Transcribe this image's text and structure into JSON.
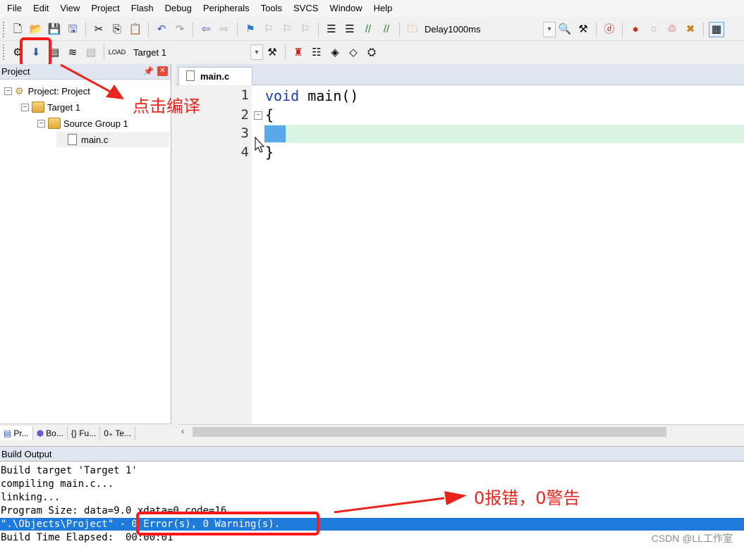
{
  "menu": [
    "File",
    "Edit",
    "View",
    "Project",
    "Flash",
    "Debug",
    "Peripherals",
    "Tools",
    "SVCS",
    "Window",
    "Help"
  ],
  "toolbar1": {
    "function_combo_value": "Delay1000ms"
  },
  "toolbar2": {
    "target_combo_value": "Target 1"
  },
  "project_pane": {
    "title": "Project",
    "tree": {
      "root": "Project: Project",
      "target": "Target 1",
      "group": "Source Group 1",
      "file": "main.c"
    },
    "tabs": [
      "Pr...",
      "Bo...",
      "{} Fu...",
      "0₊ Te..."
    ]
  },
  "editor": {
    "tab_label": "main.c",
    "line_numbers": [
      "1",
      "2",
      "3",
      "4"
    ],
    "code": {
      "line1_kw": "void",
      "line1_rest": " main()",
      "line2": "{",
      "line4": "}"
    }
  },
  "build_output": {
    "title": "Build Output",
    "lines": [
      "Build target 'Target 1'",
      "compiling main.c...",
      "linking...",
      "Program Size: data=9.0 xdata=0 code=16",
      "\".\\Objects\\Project\" - 0 Error(s), 0 Warning(s).",
      "Build Time Elapsed:  00:00:01"
    ]
  },
  "annotations": {
    "compile_hint": "点击编译",
    "result_hint": "0报错，0警告"
  },
  "watermark": "CSDN @LL工作室",
  "colors": {
    "annotation_red": "#e8241c",
    "selection_blue": "#1e7bdb",
    "current_line": "#d9f5e4",
    "keyword_blue": "#1a3db0"
  }
}
